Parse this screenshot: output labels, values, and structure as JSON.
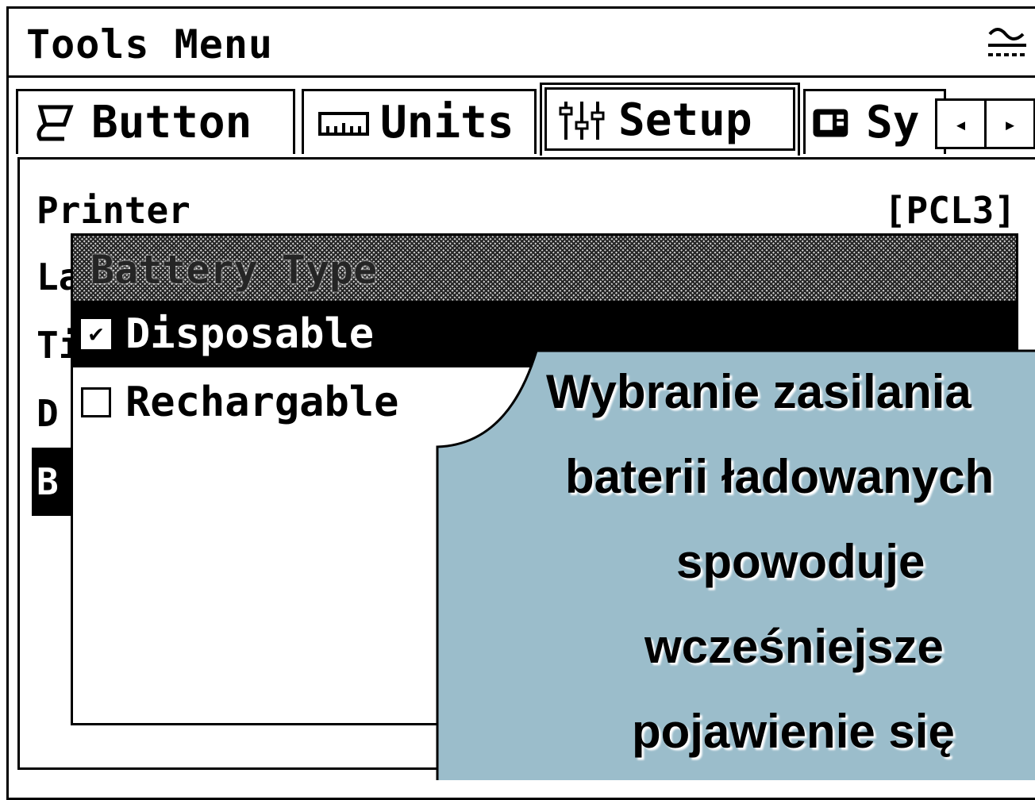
{
  "window": {
    "title": "Tools Menu",
    "icon": "pen-signal-icon"
  },
  "tabs": [
    {
      "label": "Button",
      "icon": "button-icon",
      "active": false
    },
    {
      "label": "Units",
      "icon": "ruler-icon",
      "active": false
    },
    {
      "label": "Setup",
      "icon": "sliders-icon",
      "active": true
    },
    {
      "label": "Sy",
      "icon": "system-icon",
      "active": false
    }
  ],
  "scroll": {
    "left": "◂",
    "right": "▸"
  },
  "settings": [
    {
      "label": "Printer",
      "value": "[PCL3]"
    },
    {
      "label": "La",
      "value": ""
    },
    {
      "label": "Ti",
      "value": ""
    },
    {
      "label": "D",
      "value": ""
    },
    {
      "label": "B",
      "value": ""
    }
  ],
  "dialog": {
    "title": "Battery Type",
    "options": [
      {
        "label": "Disposable",
        "checked": true,
        "mark": "✔"
      },
      {
        "label": "Rechargable",
        "checked": false,
        "mark": ""
      }
    ]
  },
  "callout": {
    "lines": [
      "Wybranie zasilania",
      "baterii ładowanych",
      "spowoduje",
      "wcześniejsze",
      "pojawienie się"
    ],
    "fill": "#9bbdcb"
  }
}
